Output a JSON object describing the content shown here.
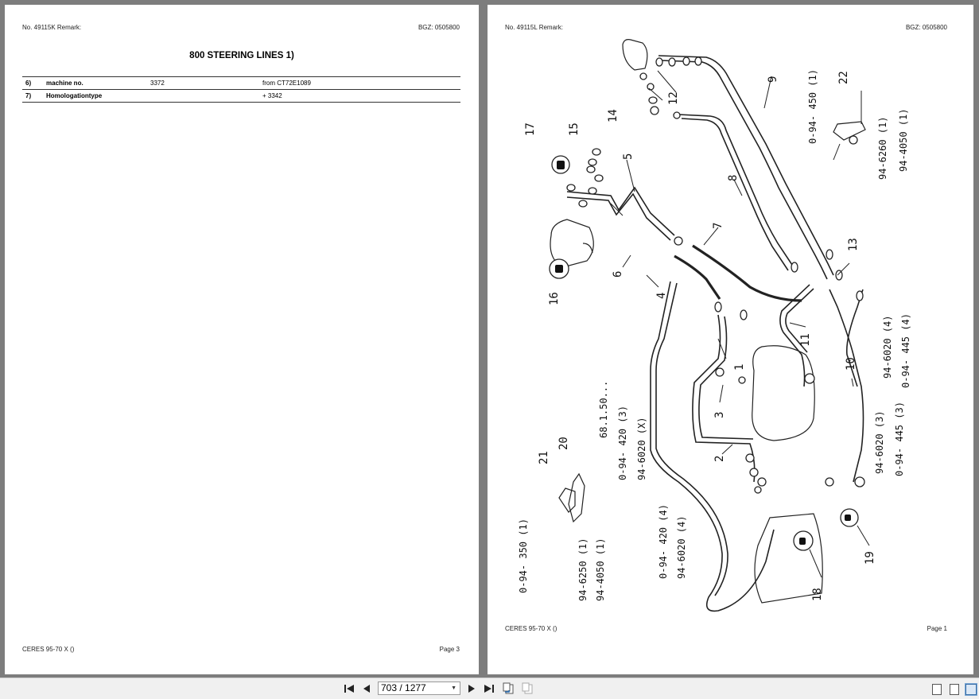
{
  "left_page": {
    "header_left": "No. 49115K   Remark:",
    "header_right": "BGZ: 0505800",
    "title": "800 STEERING LINES  1)",
    "rows": [
      {
        "num": "6)",
        "label": "machine no.",
        "value": "3372",
        "note": "from CT72E1089"
      },
      {
        "num": "7)",
        "label": "Homologationtype",
        "value": "",
        "note": "+ 3342"
      }
    ],
    "footer_left": "CERES 95-70 X ()",
    "footer_right": "Page 3"
  },
  "right_page": {
    "header_left": "No. 49115L   Remark:",
    "header_right": "BGZ: 0505800",
    "footer_left": "CERES 95-70 X ()",
    "footer_right": "Page 1",
    "callouts": [
      "1",
      "2",
      "3",
      "4",
      "5",
      "6",
      "7",
      "8",
      "9",
      "10",
      "11",
      "12",
      "13",
      "14",
      "15",
      "16",
      "17",
      "18",
      "19",
      "20",
      "21",
      "22"
    ],
    "part_refs": {
      "r9": "0-94- 450 (1)",
      "r22a": "94-6260 (1)",
      "r22b": "94-4050 (1)",
      "r10a": "94-6020 (4)",
      "r10b": "0-94- 445 (4)",
      "r10c": "94-6020 (3)",
      "r10d": "0-94- 445 (3)",
      "r2a": "68.1.50...",
      "r2b": "0-94- 420 (3)",
      "r2c": "94-6020 (X)",
      "r4a": "0-94- 420 (4)",
      "r4b": "94-6020 (4)",
      "r21": "0-94- 350 (1)",
      "r20a": "94-6250 (1)",
      "r20b": "94-4050 (1)"
    }
  },
  "toolbar": {
    "page_indicator": "703 / 1277",
    "first_icon": "first-page-icon",
    "prev_icon": "prev-page-icon",
    "next_icon": "next-page-icon",
    "last_icon": "last-page-icon"
  }
}
